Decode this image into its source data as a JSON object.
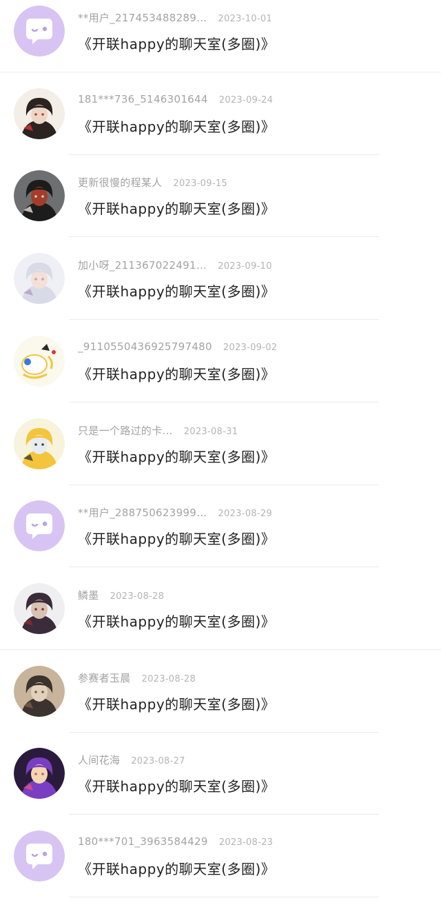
{
  "comments": [
    {
      "username": "**用户_217453488289…",
      "date": "2023-10-01",
      "title": "《开联happy的聊天室(多圈)》",
      "avatar": "default-chat-avatar"
    },
    {
      "username": "181***736_5146301644",
      "date": "2023-09-24",
      "title": "《开联happy的聊天室(多圈)》",
      "avatar": "anime-portrait-avatar"
    },
    {
      "username": "更新很慢的程某人",
      "date": "2023-09-15",
      "title": "《开联happy的聊天室(多圈)》",
      "avatar": "anime-portrait-avatar"
    },
    {
      "username": "加小呀_211367022491…",
      "date": "2023-09-10",
      "title": "《开联happy的聊天室(多圈)》",
      "avatar": "anime-portrait-avatar"
    },
    {
      "username": "_9110550436925797480",
      "date": "2023-09-02",
      "title": "《开联happy的聊天室(多圈)》",
      "avatar": "cartoon-avatar"
    },
    {
      "username": "只是一个路过的卡…",
      "date": "2023-08-31",
      "title": "《开联happy的聊天室(多圈)》",
      "avatar": "anime-portrait-avatar"
    },
    {
      "username": "**用户_288750623999…",
      "date": "2023-08-29",
      "title": "《开联happy的聊天室(多圈)》",
      "avatar": "default-chat-avatar"
    },
    {
      "username": "鳞墨",
      "date": "2023-08-28",
      "title": "《开联happy的聊天室(多圈)》",
      "avatar": "anime-portrait-avatar"
    },
    {
      "username": "参赛者玉晨",
      "date": "2023-08-28",
      "title": "《开联happy的聊天室(多圈)》",
      "avatar": "anime-portrait-avatar"
    },
    {
      "username": "人间花海",
      "date": "2023-08-27",
      "title": "《开联happy的聊天室(多圈)》",
      "avatar": "anime-portrait-avatar"
    },
    {
      "username": "180***701_3963584429",
      "date": "2023-08-23",
      "title": "《开联happy的聊天室(多圈)》",
      "avatar": "default-chat-avatar"
    }
  ],
  "colors": {
    "default_avatar_bg": "#d7c4f3",
    "username_text": "#a3a3a3",
    "date_text": "#b4b4b4",
    "title_text": "#222222",
    "divider": "#ececec"
  }
}
